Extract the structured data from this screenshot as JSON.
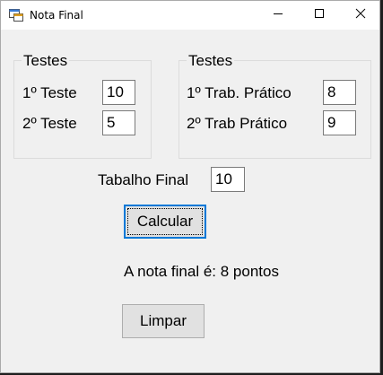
{
  "window": {
    "title": "Nota Final",
    "icons": {
      "app": "app-window-icon",
      "minimize": "minimize-icon",
      "maximize": "maximize-icon",
      "close": "close-icon"
    }
  },
  "group_left": {
    "title": "Testes",
    "row1_label": "1º Teste",
    "row1_value": "10",
    "row2_label": "2º Teste",
    "row2_value": "5"
  },
  "group_right": {
    "title": "Testes",
    "row1_label": "1º Trab. Prático",
    "row1_value": "8",
    "row2_label": "2º Trab Prático",
    "row2_value": "9"
  },
  "final_work": {
    "label": "Tabalho Final",
    "value": "10"
  },
  "calculate_button": "Calcular",
  "result_text": "A nota final é: 8 pontos",
  "clear_button": "Limpar",
  "colors": {
    "accent": "#0078d7",
    "window_bg": "#f0f0f0",
    "button_bg": "#e1e1e1"
  }
}
